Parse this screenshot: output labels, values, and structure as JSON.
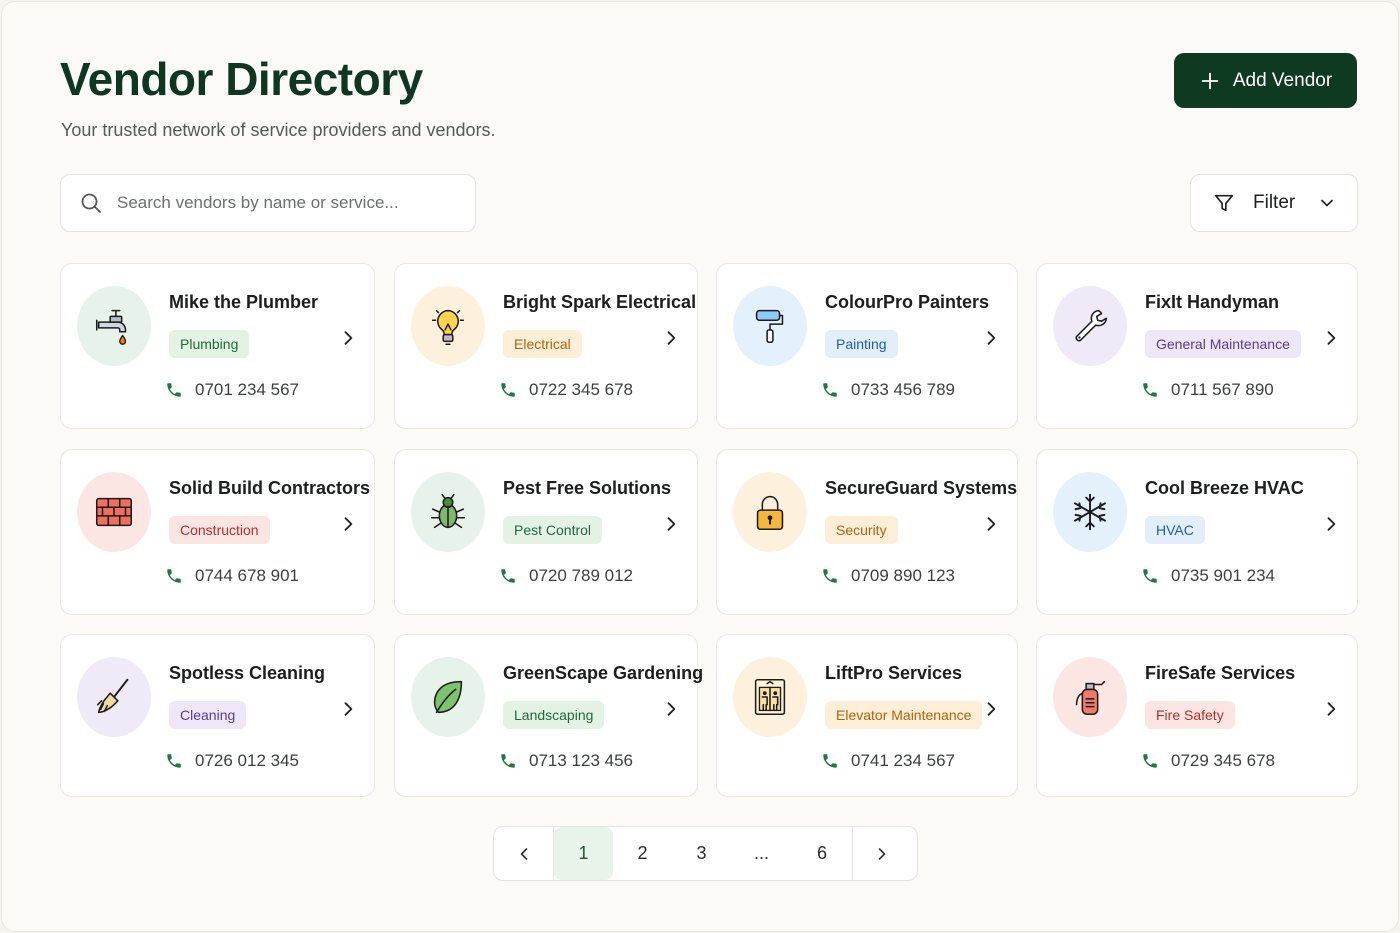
{
  "header": {
    "title": "Vendor Directory",
    "subtitle": "Your trusted network of service providers and vendors.",
    "add_label": "Add Vendor"
  },
  "search": {
    "placeholder": "Search vendors by name or service..."
  },
  "filter": {
    "label": "Filter"
  },
  "colors": {
    "brand": "#0e3a22",
    "phone_icon": "#1f7a3f"
  },
  "vendors": [
    {
      "name": "Mike the Plumber",
      "category": "Plumbing",
      "phone": "0701 234 567",
      "icon": "faucet-icon"
    },
    {
      "name": "Bright Spark Electrical",
      "category": "Electrical",
      "phone": "0722 345 678",
      "icon": "lightbulb-icon"
    },
    {
      "name": "ColourPro Painters",
      "category": "Painting",
      "phone": "0733 456 789",
      "icon": "paint-roller-icon"
    },
    {
      "name": "FixIt Handyman",
      "category": "General Maintenance",
      "phone": "0711 567 890",
      "icon": "wrench-icon"
    },
    {
      "name": "Solid Build Contractors",
      "category": "Construction",
      "phone": "0744 678 901",
      "icon": "brick-wall-icon"
    },
    {
      "name": "Pest Free Solutions",
      "category": "Pest Control",
      "phone": "0720 789 012",
      "icon": "bug-icon"
    },
    {
      "name": "SecureGuard Systems",
      "category": "Security",
      "phone": "0709 890 123",
      "icon": "padlock-icon"
    },
    {
      "name": "Cool Breeze HVAC",
      "category": "HVAC",
      "phone": "0735 901 234",
      "icon": "snowflake-icon"
    },
    {
      "name": "Spotless Cleaning",
      "category": "Cleaning",
      "phone": "0726 012 345",
      "icon": "broom-icon"
    },
    {
      "name": "GreenScape Gardening",
      "category": "Landscaping",
      "phone": "0713 123 456",
      "icon": "leaf-icon"
    },
    {
      "name": "LiftPro Services",
      "category": "Elevator Maintenance",
      "phone": "0741 234 567",
      "icon": "elevator-icon"
    },
    {
      "name": "FireSafe Services",
      "category": "Fire Safety",
      "phone": "0729 345 678",
      "icon": "fire-extinguisher-icon"
    }
  ],
  "pagination": {
    "pages": [
      "1",
      "2",
      "3",
      "...",
      "6"
    ],
    "current": "1"
  }
}
